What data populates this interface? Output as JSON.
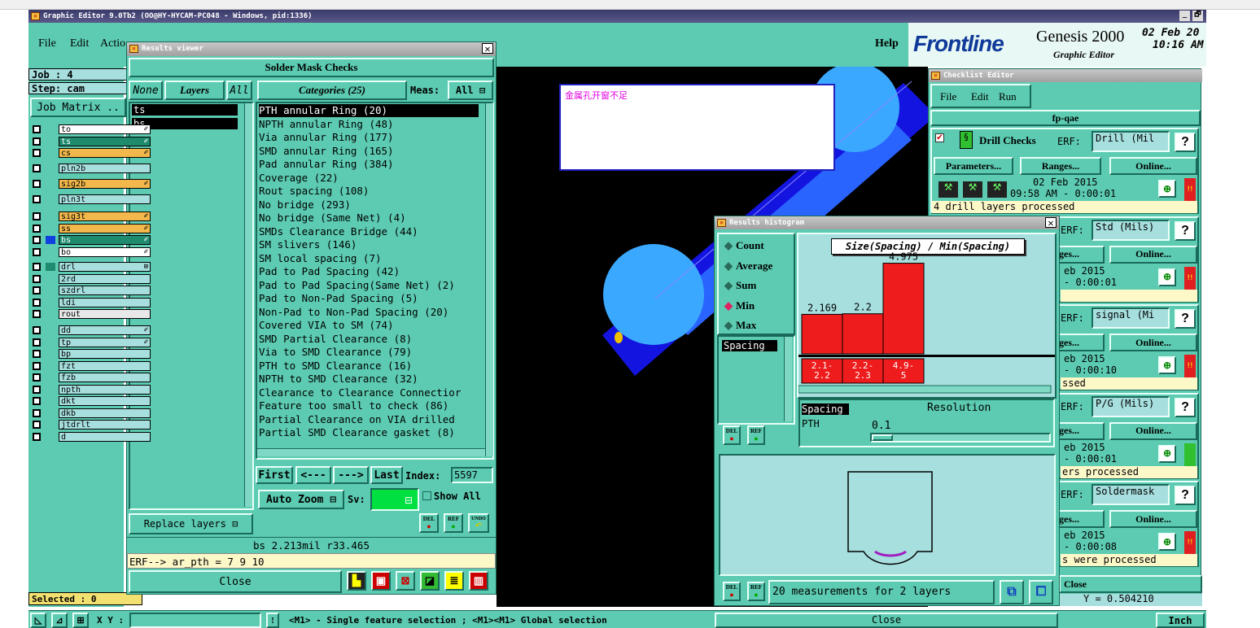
{
  "window": {
    "title": "Graphic Editor 9.0Tb2 (OO@HY-HYCAM-PC048 - Windows, pid:1336)",
    "min": "_",
    "max": "🗗"
  },
  "menu": {
    "file": "File",
    "edit": "Edit",
    "actions": "Actio",
    "help": "Help"
  },
  "brand": {
    "logo": "Frontline",
    "product": "Genesis 2000",
    "sub": "Graphic Editor",
    "date": "02 Feb 20",
    "time": "10:16 AM"
  },
  "job": {
    "job": "Job : 4",
    "step": "Step: cam",
    "matrix_btn": "Job Matrix ..",
    "selected": "Selected : 0"
  },
  "layers": [
    {
      "name": "to",
      "color": "#ffffff",
      "mark": "✐"
    },
    {
      "name": "ts",
      "color": "#1e8a6e",
      "mark": "✐"
    },
    {
      "name": "cs",
      "color": "#f2b84b",
      "mark": "✐"
    },
    {
      "name": "pln2b",
      "color": "#a7dfdf",
      "mark": ""
    },
    {
      "name": "sig2b",
      "color": "#f2b84b",
      "mark": "✐"
    },
    {
      "name": "pln3t",
      "color": "#a7dfdf",
      "mark": ""
    },
    {
      "name": "sig3t",
      "color": "#f2b84b",
      "mark": "✐"
    },
    {
      "name": "ss",
      "color": "#f2b84b",
      "mark": "✐"
    },
    {
      "name": "bs",
      "color": "#1e8a6e",
      "mark": "✐"
    },
    {
      "name": "bo",
      "color": "#ffffff",
      "mark": "✐"
    },
    {
      "name": "drl",
      "color": "#a7dfdf",
      "mark": "⊞"
    },
    {
      "name": "2rd",
      "color": "#a7dfdf",
      "mark": ""
    },
    {
      "name": "szdrl",
      "color": "#a7dfdf",
      "mark": ""
    },
    {
      "name": "ldi",
      "color": "#a7dfdf",
      "mark": ""
    },
    {
      "name": "rout",
      "color": "#e8e8e8",
      "mark": ""
    },
    {
      "name": "dd",
      "color": "#a7dfdf",
      "mark": "✐"
    },
    {
      "name": "tp",
      "color": "#a7dfdf",
      "mark": "✐"
    },
    {
      "name": "bp",
      "color": "#a7dfdf",
      "mark": ""
    },
    {
      "name": "fzt",
      "color": "#a7dfdf",
      "mark": ""
    },
    {
      "name": "fzb",
      "color": "#a7dfdf",
      "mark": ""
    },
    {
      "name": "npth",
      "color": "#a7dfdf",
      "mark": ""
    },
    {
      "name": "dkt",
      "color": "#a7dfdf",
      "mark": ""
    },
    {
      "name": "dkb",
      "color": "#a7dfdf",
      "mark": ""
    },
    {
      "name": "jtdrlt",
      "color": "#a7dfdf",
      "mark": ""
    },
    {
      "name": "d",
      "color": "#a7dfdf",
      "mark": ""
    }
  ],
  "viewer": {
    "title": "Results viewer",
    "header": "Solder Mask Checks",
    "none": "None",
    "layers": "Layers",
    "all": "All",
    "categories": "Categories (25)",
    "meas": "Meas:",
    "meas_val": "All",
    "layer_list": [
      "ts",
      "bs"
    ],
    "cats": [
      "PTH annular Ring (20)",
      "NPTH annular Ring (48)",
      "Via annular Ring (177)",
      "SMD annular Ring (165)",
      "Pad annular Ring (384)",
      "Coverage (22)",
      "Rout spacing (108)",
      "No bridge (293)",
      "No bridge (Same Net) (4)",
      "SMDs Clearance Bridge (44)",
      "SM slivers (146)",
      "SM local spacing (7)",
      "Pad to Pad Spacing (42)",
      "Pad to Pad Spacing(Same Net) (2)",
      "Pad to Non-Pad Spacing (5)",
      "Non-Pad to Non-Pad Spacing (20)",
      "Covered VIA to SM (74)",
      "SMD Partial Clearance (8)",
      "Via to SMD Clearance (79)",
      "PTH to SMD Clearance (16)",
      "NPTH to SMD Clearance (32)",
      "Clearance to Clearance Connectior",
      "Feature too small to check (86)",
      "Partial Clearance on VIA drilled",
      "Partial SMD Clearance gasket (8)"
    ],
    "first": "First",
    "prev": "<---",
    "next": "--->",
    "last": "Last",
    "index_label": "Index:",
    "index_val": "5597",
    "auto_zoom": "Auto Zoom",
    "sv": "Sv:",
    "show_all": "Show All",
    "replace": "Replace layers",
    "status": "bs 2.213mil  r33.465",
    "erf": "ERF--> ar_pth = 7 9 10",
    "close": "Close",
    "del": "DEL",
    "ref": "REF",
    "undo": "UNDO"
  },
  "note": {
    "text": "金属孔开窗不足"
  },
  "hist": {
    "title": "Results histogram",
    "opts": [
      "Count",
      "Average",
      "Sum",
      "Min",
      "Max"
    ],
    "selected": "Min",
    "chart_title": "Size(Spacing) / Min(Spacing)",
    "list1": "Spacing",
    "spacing2": "Spacing",
    "pth": "PTH",
    "resolution": "Resolution",
    "res_val": "0.1",
    "measurements": "20 measurements for 2 layers",
    "close": "Close",
    "del": "DEL",
    "ref": "REF"
  },
  "chart_data": {
    "type": "bar",
    "title": "Size(Spacing) / Min(Spacing)",
    "categories": [
      "2.1-\n2.2",
      "2.2-\n2.3",
      "4.9-\n5"
    ],
    "values": [
      2.169,
      2.2,
      4.975
    ],
    "value_labels": [
      "2.169",
      "2.2",
      "4.975"
    ],
    "bar_color": "#ee1c1c"
  },
  "checklist": {
    "title": "Checklist Editor",
    "file": "File",
    "edit": "Edit",
    "run": "Run",
    "name": "fp-qae",
    "erf": "ERF:",
    "params": "Parameters...",
    "ranges": "Ranges...",
    "online": "Online...",
    "ranges_short": "ges...",
    "checks": [
      {
        "label": "Drill Checks",
        "erf": "Drill (Mil",
        "date": "02 Feb 2015",
        "time": "09:58 AM - 0:00:01",
        "msg": "4 drill layers processed",
        "status": "#e02020"
      },
      {
        "label": "",
        "erf": "Std (Mils)",
        "date": "eb 2015",
        "time": "- 0:00:01",
        "msg": "",
        "status": "#e02020"
      },
      {
        "label": "",
        "erf": "signal (Mi",
        "date": "eb 2015",
        "time": "- 0:00:10",
        "msg": "ssed",
        "status": "#e02020"
      },
      {
        "label": "",
        "erf": "P/G (Mils)",
        "date": "eb 2015",
        "time": "- 0:00:01",
        "msg": "ers processed",
        "status": "#30c030"
      },
      {
        "label": "",
        "erf": "Soldermask",
        "date": "eb 2015",
        "time": "- 0:00:08",
        "msg": "s were processed",
        "status": "#e02020"
      }
    ],
    "close": "Close",
    "coord": "Y = 0.504210",
    "inch": "Inch"
  },
  "statusbar": {
    "xy": "X Y :",
    "hint": "<M1> - Single feature selection ; <M1><M1> Global selection",
    "excl": "!"
  }
}
